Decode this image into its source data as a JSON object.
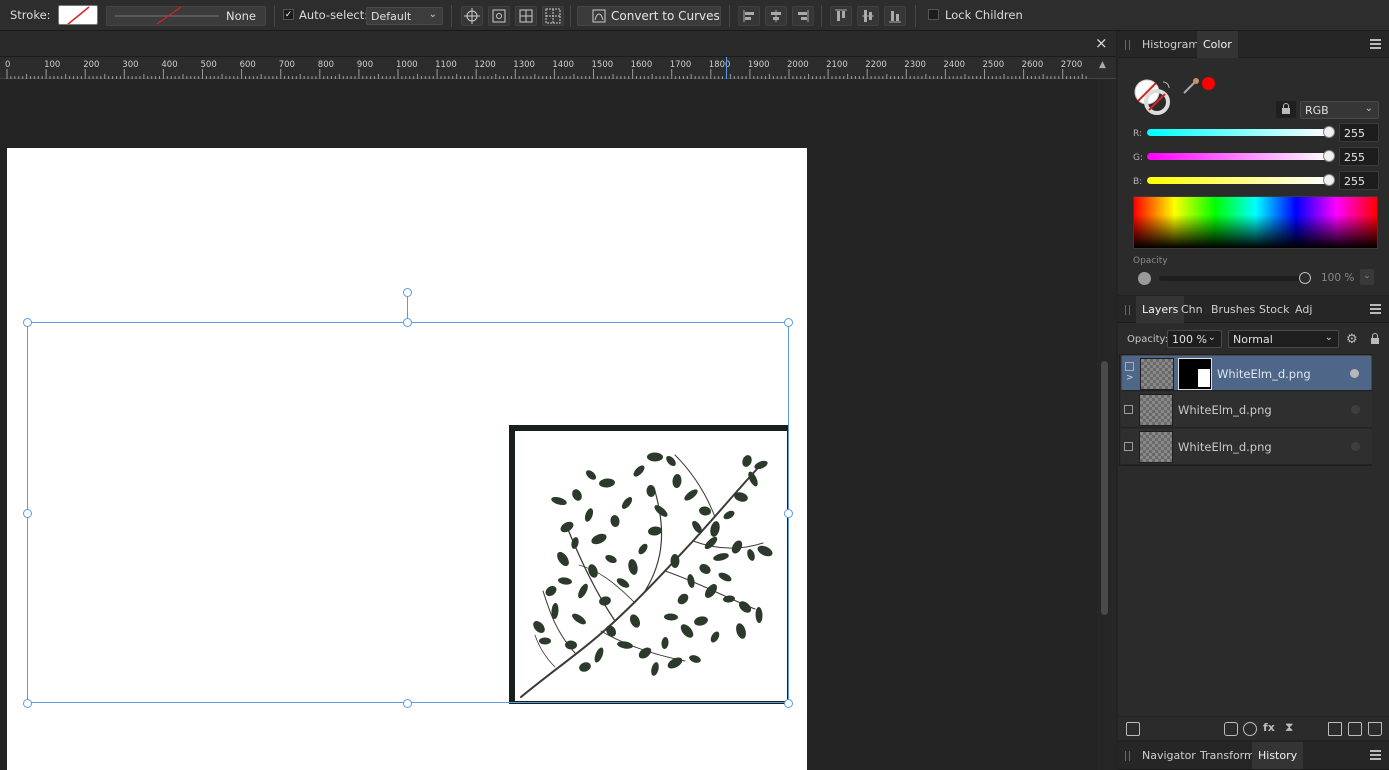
{
  "toolbar": {
    "stroke_label": "Stroke:",
    "stroke_width_value": "None",
    "auto_select_label": "Auto-select:",
    "auto_select_checked": "✓",
    "auto_select_mode": "Default",
    "convert_to_curves_label": "Convert to Curves",
    "lock_children_label": "Lock Children"
  },
  "document_tab": {
    "close_glyph": "×"
  },
  "ruler": {
    "ticks": [
      "0",
      "100",
      "200",
      "300",
      "400",
      "500",
      "600",
      "700",
      "800",
      "900",
      "1000",
      "1100",
      "1200",
      "1300",
      "1400",
      "1500",
      "1600",
      "1700",
      "1800",
      "1900",
      "2000",
      "2100",
      "2200",
      "2300",
      "2400",
      "2500",
      "2600",
      "2700"
    ]
  },
  "color_panel": {
    "tabs": [
      {
        "label": "Histogram"
      },
      {
        "label": "Color"
      }
    ],
    "active_tab": "Color",
    "model": "RGB",
    "channels": [
      {
        "label": "R:",
        "value": "255",
        "level": 1.0
      },
      {
        "label": "G:",
        "value": "255",
        "level": 1.0
      },
      {
        "label": "B:",
        "value": "255",
        "level": 1.0
      }
    ],
    "opacity_label": "Opacity",
    "opacity_value": "100 %",
    "opacity_level": 1.0,
    "colors": {
      "picker_dot": "#ff0000",
      "accent": "#5b9be6"
    }
  },
  "layers_panel": {
    "tabs": [
      {
        "label": "Layers"
      },
      {
        "label": "Chn"
      },
      {
        "label": "Brushes"
      },
      {
        "label": "Stock"
      },
      {
        "label": "Adj"
      }
    ],
    "active_tab": "Layers",
    "opacity_label": "Opacity:",
    "opacity_value": "100 %",
    "blend_mode": "Normal",
    "layers": [
      {
        "name": "WhiteElm_d.png",
        "selected": true,
        "has_mask": true
      },
      {
        "name": "WhiteElm_d.png",
        "selected": false,
        "has_mask": false
      },
      {
        "name": "WhiteElm_d.png",
        "selected": false,
        "has_mask": false
      }
    ]
  },
  "bottom_panel": {
    "tabs": [
      {
        "label": "Navigator"
      },
      {
        "label": "Transform"
      },
      {
        "label": "History"
      }
    ],
    "active_tab": "History"
  }
}
